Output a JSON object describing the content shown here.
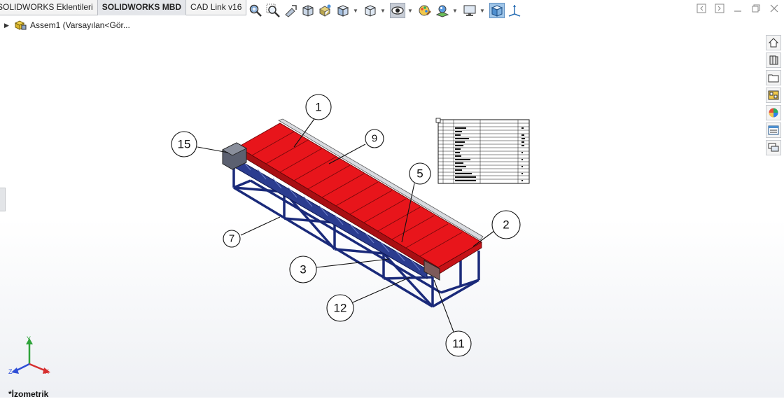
{
  "tabs": [
    {
      "label": "SOLIDWORKS Eklentileri",
      "active": false
    },
    {
      "label": "SOLIDWORKS MBD",
      "active": true
    },
    {
      "label": "CAD Link v16",
      "active": false
    }
  ],
  "toolbar": {
    "icons": [
      "zoom-to-fit-icon",
      "zoom-to-area-icon",
      "previous-view-icon",
      "section-view-icon",
      "dynamic-annotation-views-icon",
      "view-orientation-icon",
      "display-style-icon",
      "hide-show-items-icon",
      "edit-appearance-icon",
      "apply-scene-icon",
      "view-settings-icon",
      "view-selector-icon",
      "3d-axis-icon"
    ]
  },
  "tree": {
    "root_label": "Assem1  (Varsayılan<Gör..."
  },
  "view": {
    "orientation_label": "*İzometrik"
  },
  "balloons": [
    "1",
    "15",
    "9",
    "5",
    "2",
    "7",
    "3",
    "12",
    "11"
  ],
  "triad": {
    "x_label": "X",
    "y_label": "Y",
    "z_label": "Z"
  },
  "colors": {
    "belt": "#e8151b",
    "frame": "#1a2a7a",
    "accent": "#5d8fc2"
  }
}
